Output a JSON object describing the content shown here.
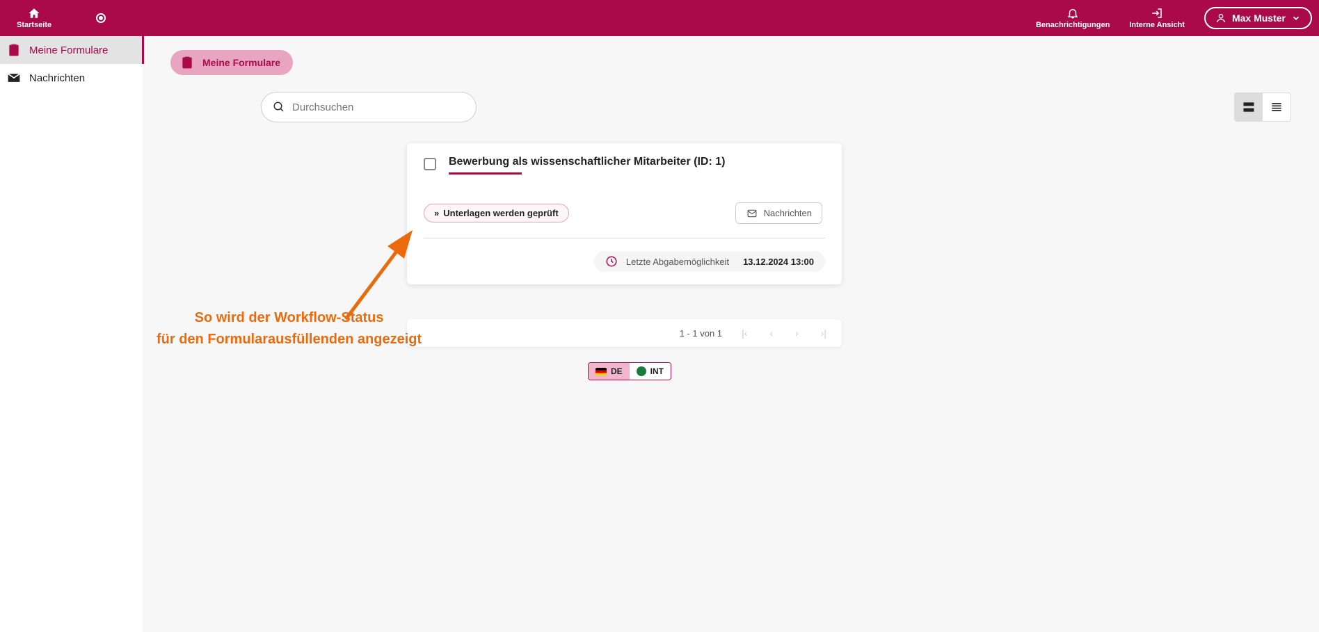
{
  "topbar": {
    "home_label": "Startseite",
    "notifications_label": "Benachrichtigungen",
    "internal_view_label": "Interne Ansicht",
    "user_name": "Max Muster"
  },
  "sidebar": {
    "items": [
      {
        "label": "Meine Formulare"
      },
      {
        "label": "Nachrichten"
      }
    ]
  },
  "page": {
    "chip_label": "Meine Formulare",
    "search_placeholder": "Durchsuchen"
  },
  "card": {
    "title": "Bewerbung als wissenschaftlicher Mitarbeiter (ID: 1)",
    "status_label": "Unterlagen werden geprüft",
    "messages_label": "Nachrichten",
    "deadline_label": "Letzte Abgabemöglichkeit",
    "deadline_value": "13.12.2024 13:00"
  },
  "annotation": {
    "line1": "So wird der Workflow-Status",
    "line2": "für den Formularausfüllenden angezeigt"
  },
  "pagination": {
    "range_text": "1 - 1 von 1"
  },
  "lang": {
    "de": "DE",
    "int": "INT"
  }
}
